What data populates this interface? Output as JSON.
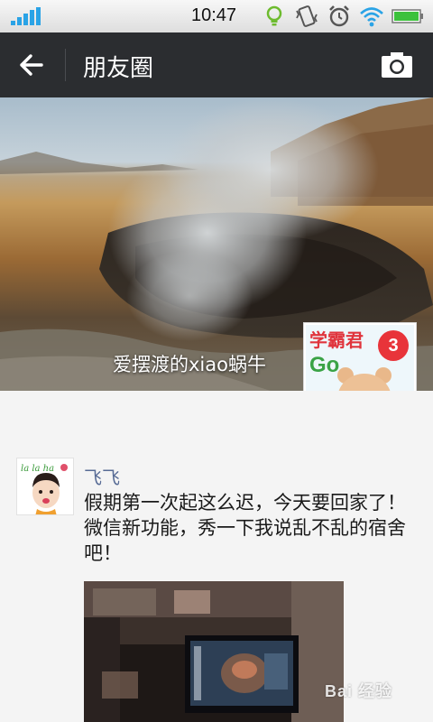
{
  "status_bar": {
    "time": "10:47",
    "icons": [
      "signal-icon",
      "bulb-icon",
      "vibrate-icon",
      "alarm-icon",
      "wifi-icon",
      "battery-icon"
    ],
    "accent_color": "#2aa3e6",
    "battery_color": "#3cc13c"
  },
  "nav": {
    "back_icon": "arrow-left-icon",
    "title": "朋友圈",
    "camera_icon": "camera-icon",
    "background": "#2b2d30"
  },
  "cover": {
    "user_name": "爱摆渡的xiao蜗牛",
    "avatar": {
      "text_top": "学霸君",
      "text_go": "Go",
      "badge": "3"
    }
  },
  "post": {
    "author": "飞飞",
    "author_color": "#576b95",
    "text": "假期第一次起这么迟，今天要回家了！微信新功能，秀一下我说乱不乱的宿舍吧！",
    "avatar_text": "la la ha"
  },
  "watermark": "Bai 经验"
}
